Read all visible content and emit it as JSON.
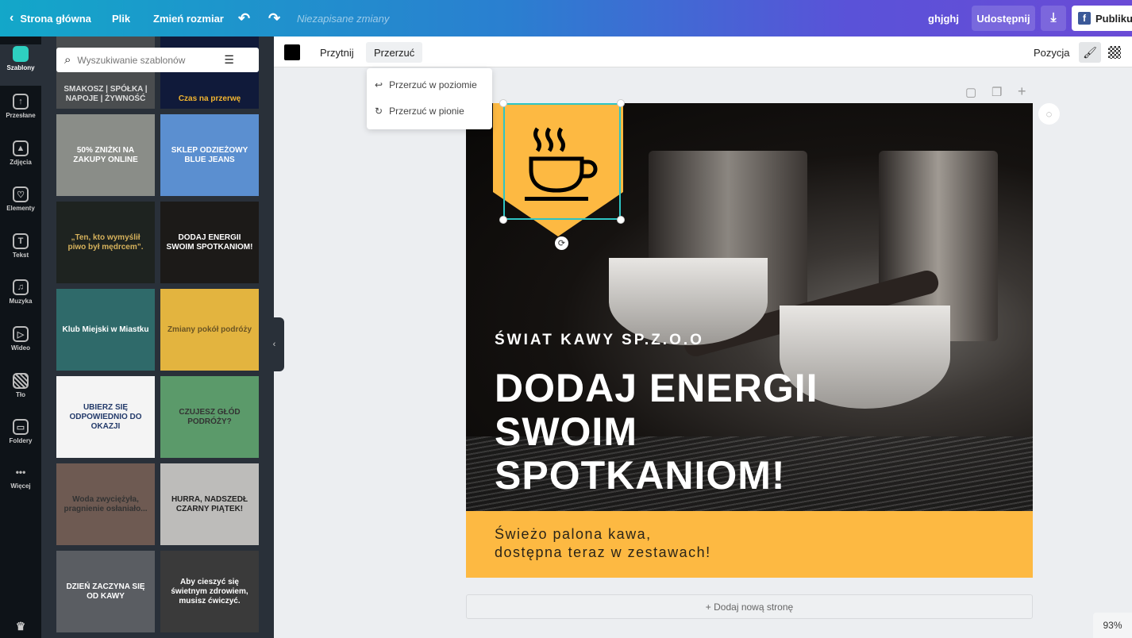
{
  "topbar": {
    "home": "Strona główna",
    "file": "Plik",
    "resize": "Zmień rozmiar",
    "unsaved": "Niezapisane zmiany",
    "project_name": "ghjghj",
    "share": "Udostępnij",
    "publish": "Publikuj"
  },
  "rail": [
    {
      "label": "Szablony",
      "icon": "templates-icon"
    },
    {
      "label": "Przesłane",
      "icon": "upload-icon"
    },
    {
      "label": "Zdjęcia",
      "icon": "photos-icon"
    },
    {
      "label": "Elementy",
      "icon": "elements-icon"
    },
    {
      "label": "Tekst",
      "icon": "text-icon"
    },
    {
      "label": "Muzyka",
      "icon": "music-icon"
    },
    {
      "label": "Wideo",
      "icon": "video-icon"
    },
    {
      "label": "Tło",
      "icon": "background-icon"
    },
    {
      "label": "Foldery",
      "icon": "folder-icon"
    },
    {
      "label": "Więcej",
      "icon": "more-icon"
    }
  ],
  "panel": {
    "search_placeholder": "Wyszukiwanie szablonów",
    "templates": [
      {
        "text": "SMAKOSZ | SPÓŁKA | NAPOJE | ŻYWNOŚĆ",
        "bg": "#4a4d4f",
        "fg": "#ddd"
      },
      {
        "text": "Czas na przerwę",
        "bg": "#101a3a",
        "fg": "#f2b530"
      },
      {
        "text": "50% ZNIŻKI NA ZAKUPY ONLINE",
        "bg": "#8a8d88",
        "fg": "#fff"
      },
      {
        "text": "SKLEP ODZIEŻOWY BLUE JEANS",
        "bg": "#5b8fd0",
        "fg": "#fff"
      },
      {
        "text": "„Ten, kto wymyślił piwo był mędrcem”.",
        "bg": "#1e2320",
        "fg": "#d6b25c"
      },
      {
        "text": "DODAJ ENERGII SWOIM SPOTKANIOM!",
        "bg": "#1c1a18",
        "fg": "#fff"
      },
      {
        "text": "Klub Miejski w Miastku",
        "bg": "#2f6a6a",
        "fg": "#fff"
      },
      {
        "text": "Zmiany pokół podróży",
        "bg": "#e3b43f",
        "fg": "#6a5424"
      },
      {
        "text": "UBIERZ SIĘ ODPOWIEDNIO DO OKAZJI",
        "bg": "#f4f4f4",
        "fg": "#233a6a"
      },
      {
        "text": "CZUJESZ GŁÓD PODRÓŻY?",
        "bg": "#5b9a6a",
        "fg": "#333"
      },
      {
        "text": "Woda zwyciężyła, pragnienie osłaniało...",
        "bg": "#6e5a52",
        "fg": "#333"
      },
      {
        "text": "HURRA, NADSZEDŁ CZARNY PIĄTEK!",
        "bg": "#bdbcba",
        "fg": "#222"
      },
      {
        "text": "DZIEŃ ZACZYNA SIĘ OD KAWY",
        "bg": "#5a5d62",
        "fg": "#fff"
      },
      {
        "text": "Aby cieszyć się świetnym zdrowiem, musisz ćwiczyć.",
        "bg": "#3a3a3a",
        "fg": "#fff"
      }
    ]
  },
  "toolbar": {
    "crop": "Przytnij",
    "flip": "Przerzuć",
    "position": "Pozycja",
    "color": "#000000"
  },
  "flip_menu": {
    "horizontal": "Przerzuć w poziomie",
    "vertical": "Przerzuć w pionie"
  },
  "design": {
    "subtitle": "ŚWIAT KAWY SP.Z.O.O",
    "headline_1": "DODAJ ENERGII",
    "headline_2": "SWOIM",
    "headline_3": "SPOTKANIOM!",
    "tagline_1": "Świeżo palona kawa,",
    "tagline_2": "dostępna teraz w zestawach!",
    "accent": "#fdb942"
  },
  "add_page": "+ Dodaj nową stronę",
  "zoom": "93%"
}
